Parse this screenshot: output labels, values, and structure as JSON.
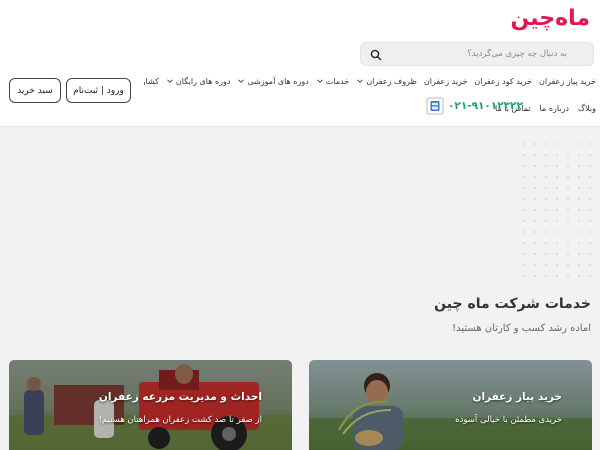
{
  "brand": {
    "logo_text": "ماه‌چین",
    "accent": "#e0174f",
    "phone_color": "#1aa261"
  },
  "search": {
    "placeholder": "به دنبال چه چیزی می‌گردید؟",
    "icon": "search-icon"
  },
  "nav": {
    "items": [
      {
        "label": "خرید پیاز زعفران",
        "dropdown": false
      },
      {
        "label": "خرید کود زعفران",
        "dropdown": false
      },
      {
        "label": "خرید زعفران",
        "dropdown": false
      },
      {
        "label": "ظروف زعفران",
        "dropdown": true
      },
      {
        "label": "خدمات",
        "dropdown": true
      },
      {
        "label": "دوره های آموزشی",
        "dropdown": true
      },
      {
        "label": "دوره های رایگان",
        "dropdown": true
      },
      {
        "label": "کشاورزان",
        "dropdown": true
      }
    ],
    "secondary": [
      {
        "label": "وبلاگ"
      },
      {
        "label": "درباره ما"
      },
      {
        "label": "تماس با ما"
      }
    ]
  },
  "contact": {
    "phone": "۰۲۱-۹۱۰۱۲۳۲۲"
  },
  "buttons": {
    "login": "ورود | ثبت‌نام",
    "cart": "سبد خرید"
  },
  "section": {
    "title": "خدمات شرکت ماه چین",
    "subtitle": "اماده رشد کسب و کارتان هستید!"
  },
  "cards": [
    {
      "title": "خرید پیاز زعفران",
      "subtitle": "خریدی مطمئن با خیالی آسوده"
    },
    {
      "title": "احداث و مدیریت مزرعه زعفران",
      "subtitle": "از صفر تا صد کشت زعفران همراهتان هستیم!"
    }
  ]
}
